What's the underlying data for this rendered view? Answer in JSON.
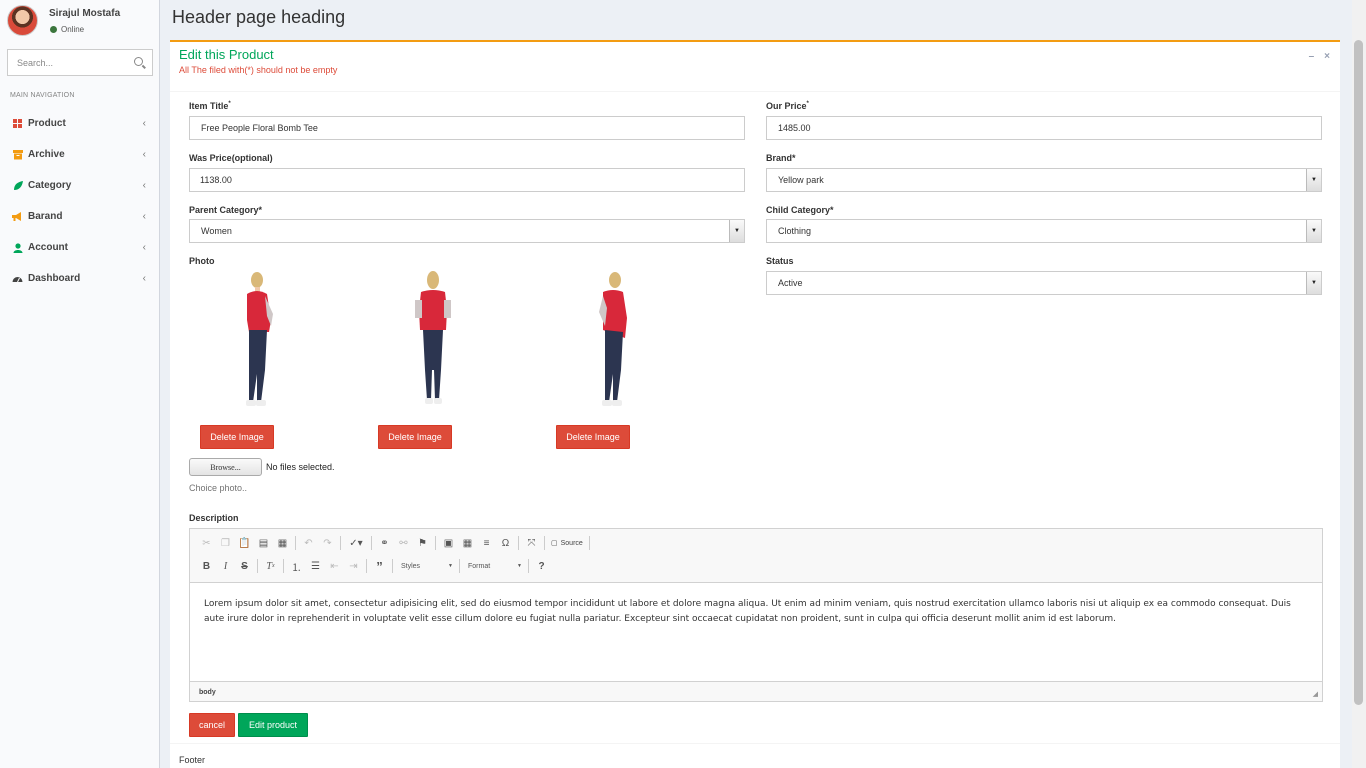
{
  "user": {
    "name": "Sirajul Mostafa",
    "status": "Online"
  },
  "search": {
    "placeholder": "Search..."
  },
  "nav": {
    "header": "MAIN NAVIGATION",
    "items": [
      {
        "label": "Product",
        "icon": "cubes-icon",
        "color": "#dd4b39"
      },
      {
        "label": "Archive",
        "icon": "archive-icon",
        "color": "#f39c12"
      },
      {
        "label": "Category",
        "icon": "leaf-icon",
        "color": "#00a65a"
      },
      {
        "label": "Barand",
        "icon": "bullhorn-icon",
        "color": "#f39c12"
      },
      {
        "label": "Account",
        "icon": "user-icon",
        "color": "#00a65a"
      },
      {
        "label": "Dashboard",
        "icon": "dashboard-icon",
        "color": "#444444"
      }
    ]
  },
  "page": {
    "heading": "Header page heading"
  },
  "box": {
    "title": "Edit this Product",
    "subtitle": "All The filed with(*) should not be empty"
  },
  "form": {
    "item_title": {
      "label": "Item Title",
      "required_mark": "*",
      "value": "Free People Floral Bomb Tee"
    },
    "our_price": {
      "label": "Our Price",
      "required_mark": "*",
      "value": "1485.00"
    },
    "was_price": {
      "label": "Was Price(optional)",
      "value": "1138.00"
    },
    "brand": {
      "label": "Brand*",
      "value": "Yellow park"
    },
    "parent_category": {
      "label": "Parent Category*",
      "value": "Women"
    },
    "child_category": {
      "label": "Child Category*",
      "value": "Clothing"
    },
    "photo": {
      "label": "Photo"
    },
    "status": {
      "label": "Status",
      "value": "Active"
    },
    "photos": [
      {
        "delete_label": "Delete Image"
      },
      {
        "delete_label": "Delete Image"
      },
      {
        "delete_label": "Delete Image"
      }
    ],
    "file": {
      "browse_label": "Browse...",
      "status": "No files selected.",
      "help": "Choice photo.."
    },
    "description": {
      "label": "Description"
    },
    "cancel_label": "cancel",
    "submit_label": "Edit product"
  },
  "editor": {
    "source_label": "Source",
    "styles_label": "Styles",
    "format_label": "Format",
    "content": "Lorem ipsum dolor sit amet, consectetur adipisicing elit, sed do eiusmod tempor incididunt ut labore et dolore magna aliqua. Ut enim ad minim veniam, quis nostrud exercitation ullamco laboris nisi ut aliquip ex ea commodo consequat. Duis aute irure dolor in reprehenderit in voluptate velit esse cillum dolore eu fugiat nulla pariatur. Excepteur sint occaecat cupidatat non proident, sunt in culpa qui officia deserunt mollit anim id est laborum.",
    "path": "body"
  },
  "footer": {
    "text": "Footer"
  },
  "colors": {
    "accent": "#f39c12",
    "success": "#00a65a",
    "danger": "#dd4b39"
  }
}
